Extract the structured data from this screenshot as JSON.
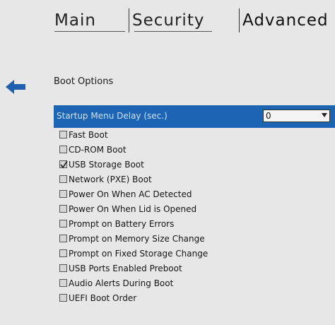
{
  "tabs": [
    {
      "label": "Main"
    },
    {
      "label": "Security"
    },
    {
      "label": "Advanced"
    }
  ],
  "boot": {
    "title": "Boot Options",
    "startup_delay": {
      "label": "Startup Menu Delay (sec.)",
      "value": "0"
    },
    "options": [
      {
        "label": "Fast Boot",
        "checked": false
      },
      {
        "label": "CD-ROM Boot",
        "checked": false
      },
      {
        "label": "USB Storage Boot",
        "checked": true
      },
      {
        "label": "Network (PXE) Boot",
        "checked": false
      },
      {
        "label": "Power On When AC Detected",
        "checked": false
      },
      {
        "label": "Power On When Lid is Opened",
        "checked": false
      },
      {
        "label": "Prompt on Battery Errors",
        "checked": false
      },
      {
        "label": "Prompt on Memory Size Change",
        "checked": false
      },
      {
        "label": "Prompt on Fixed Storage Change",
        "checked": false
      },
      {
        "label": "USB Ports Enabled Preboot",
        "checked": false
      },
      {
        "label": "Audio Alerts During Boot",
        "checked": false
      },
      {
        "label": "UEFI Boot Order",
        "checked": false
      }
    ]
  },
  "colors": {
    "highlight": "#1d64b5",
    "back_arrow": "#1f5fb0"
  }
}
